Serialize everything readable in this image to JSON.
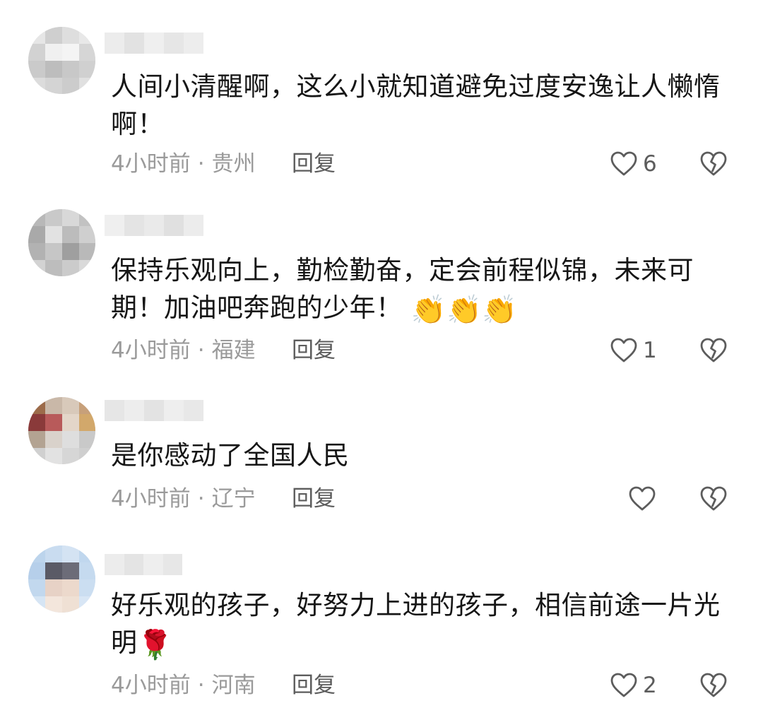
{
  "comments": [
    {
      "text": "人间小清醒啊，这么小就知道避免过度安逸让人懒惰啊！",
      "time": "4小时前",
      "location": "贵州",
      "reply_label": "回复",
      "likes": "6",
      "emoji": ""
    },
    {
      "text": "保持乐观向上，勤检勤奋，定会前程似锦，未来可期！加油吧奔跑的少年！",
      "time": "4小时前",
      "location": "福建",
      "reply_label": "回复",
      "likes": "1",
      "emoji": "👏👏👏"
    },
    {
      "text": "是你感动了全国人民",
      "time": "4小时前",
      "location": "辽宁",
      "reply_label": "回复",
      "likes": "",
      "emoji": ""
    },
    {
      "text": "好乐观的孩子，好努力上进的孩子，相信前途一片光明",
      "time": "4小时前",
      "location": "河南",
      "reply_label": "回复",
      "likes": "2",
      "emoji": "🌹"
    }
  ],
  "icons": {
    "like": "heart-outline-icon",
    "dislike": "broken-heart-icon"
  },
  "colors": {
    "text": "#161616",
    "meta": "#9a9a9a",
    "action": "#5c5c5c"
  }
}
